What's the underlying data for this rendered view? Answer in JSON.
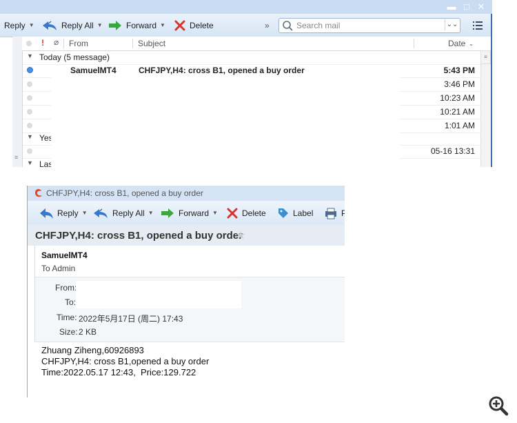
{
  "mail_list": {
    "toolbar": {
      "reply": "Reply",
      "reply_all": "Reply All",
      "forward": "Forward",
      "delete": "Delete",
      "more": "»"
    },
    "search": {
      "placeholder": "Search mail"
    },
    "columns": {
      "from": "From",
      "subject": "Subject",
      "date": "Date"
    },
    "groups": [
      {
        "label": "Today (5 message)"
      },
      {
        "label": "Yes"
      },
      {
        "label": "Las"
      }
    ],
    "messages": [
      {
        "from": "SamuelMT4",
        "subject": "CHFJPY,H4: cross B1, opened a buy order",
        "time": "5:43 PM",
        "unread": true
      },
      {
        "from": "",
        "subject": "",
        "time": "3:46 PM",
        "unread": false
      },
      {
        "from": "",
        "subject": "",
        "time": "10:23 AM",
        "unread": false
      },
      {
        "from": "",
        "subject": "",
        "time": "10:21 AM",
        "unread": false
      },
      {
        "from": "",
        "subject": "",
        "time": "1:01 AM",
        "unread": false
      },
      {
        "from": "",
        "subject": "",
        "time": "05-16 13:31",
        "unread": false
      }
    ]
  },
  "message_window": {
    "title": "CHFJPY,H4: cross B1, opened a buy order",
    "toolbar": {
      "reply": "Reply",
      "reply_all": "Reply All",
      "forward": "Forward",
      "delete": "Delete",
      "label": "Label",
      "print_partial": "P"
    },
    "subject": "CHFJPY,H4: cross B1, opened a buy order",
    "sender": "SamuelMT4",
    "to_line": "To Admin",
    "details": {
      "from_label": "From:",
      "to_label": "To:",
      "time_label": "Time:",
      "time_value": "2022年5月17日 (周二) 17:43",
      "size_label": "Size:",
      "size_value": "2 KB"
    },
    "body": [
      "Zhuang Ziheng,60926893",
      "CHFJPY,H4: cross B1,opened a buy order",
      "Time:2022.05.17 12:43,  Price:129.722"
    ]
  },
  "colors": {
    "accent": "#4a90e2",
    "delete_red": "#d9342b",
    "forward_green": "#3aa83a",
    "reply_blue": "#3a78c9",
    "app_logo_red": "#e2462d"
  },
  "icons": [
    "reply-icon",
    "reply-all-icon",
    "forward-icon",
    "delete-icon",
    "search-icon",
    "filter-icon",
    "menu-icon",
    "label-icon",
    "print-icon",
    "star-icon",
    "zoom-in-icon",
    "app-logo-icon"
  ]
}
